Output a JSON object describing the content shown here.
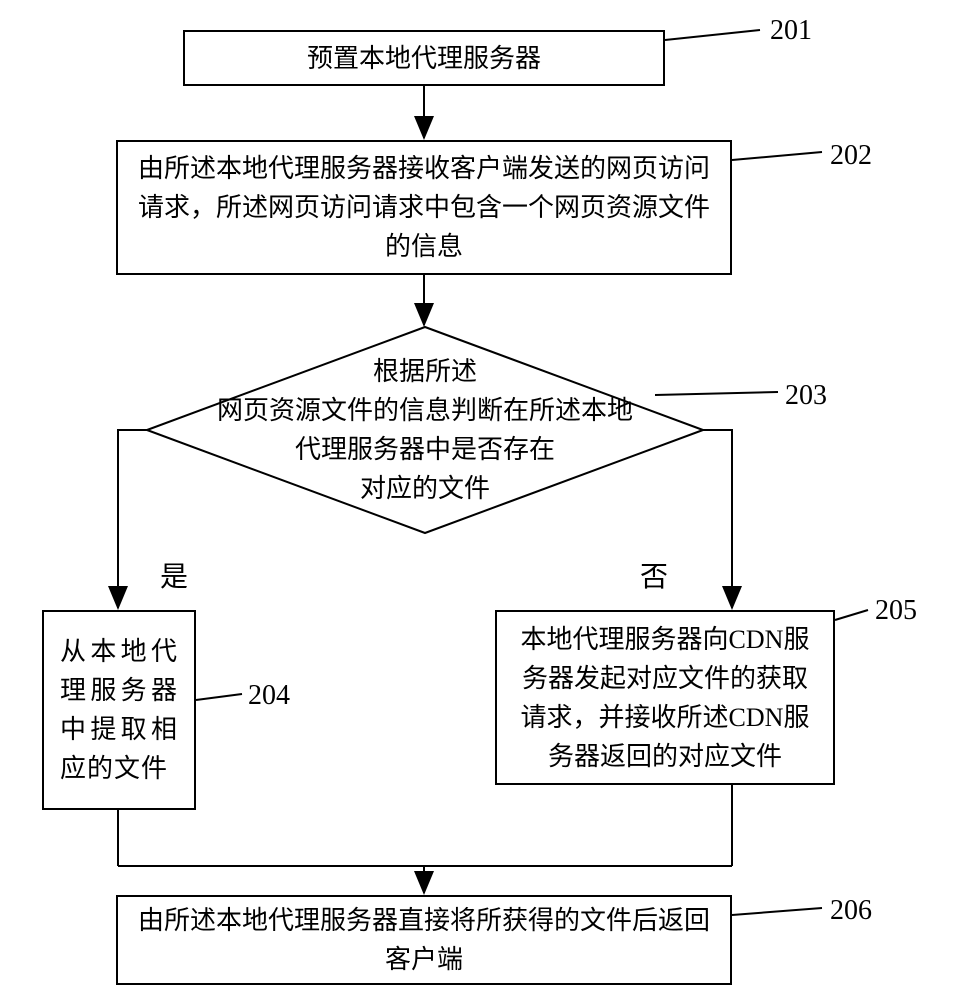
{
  "flow": {
    "step201": {
      "num": "201",
      "text": "预置本地代理服务器"
    },
    "step202": {
      "num": "202",
      "text": "由所述本地代理服务器接收客户端发送的网页访问请求，所述网页访问请求中包含一个网页资源文件的信息"
    },
    "step203": {
      "num": "203",
      "text": "根据所述\n网页资源文件的信息判断在所述本地\n代理服务器中是否存在\n对应的文件"
    },
    "step204": {
      "num": "204",
      "text": "从本地代理服务器中提取相应的文件"
    },
    "step205": {
      "num": "205",
      "text": "本地代理服务器向CDN服务器发起对应文件的获取请求，并接收所述CDN服务器返回的对应文件"
    },
    "step206": {
      "num": "206",
      "text": "由所述本地代理服务器直接将所获得的文件后返回客户端"
    },
    "branch_yes": "是",
    "branch_no": "否"
  }
}
